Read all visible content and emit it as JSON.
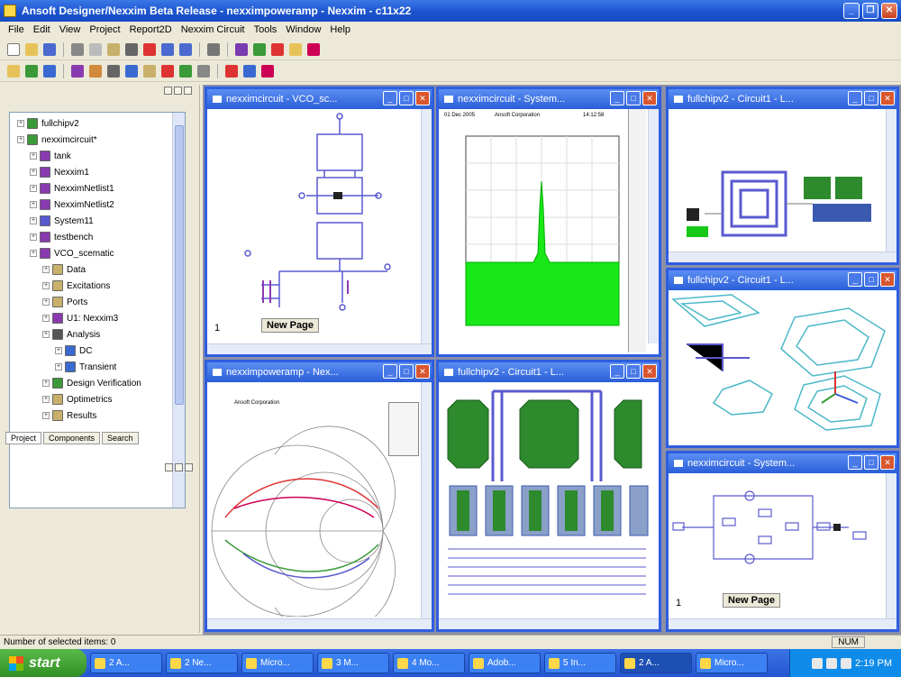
{
  "app": {
    "title": "Ansoft Designer/Nexxim Beta Release - nexximpoweramp - Nexxim - c11x22"
  },
  "menu": [
    "File",
    "Edit",
    "View",
    "Project",
    "Report2D",
    "Nexxim Circuit",
    "Tools",
    "Window",
    "Help"
  ],
  "tree": {
    "items": [
      {
        "label": "fullchipv2",
        "indent": 0,
        "icon": "project-icon",
        "color": "#3a9a3a"
      },
      {
        "label": "nexximcircuit*",
        "indent": 0,
        "icon": "project-icon",
        "color": "#3a9a3a"
      },
      {
        "label": "tank",
        "indent": 1,
        "icon": "circuit-icon",
        "color": "#8a3ab0"
      },
      {
        "label": "Nexxim1",
        "indent": 1,
        "icon": "circuit-icon",
        "color": "#8a3ab0"
      },
      {
        "label": "NexximNetlist1",
        "indent": 1,
        "icon": "circuit-icon",
        "color": "#8a3ab0"
      },
      {
        "label": "NexximNetlist2",
        "indent": 1,
        "icon": "circuit-icon",
        "color": "#8a3ab0"
      },
      {
        "label": "System11",
        "indent": 1,
        "icon": "system-icon",
        "color": "#5a5ad0"
      },
      {
        "label": "testbench",
        "indent": 1,
        "icon": "circuit-icon",
        "color": "#8a3ab0"
      },
      {
        "label": "VCO_scematic",
        "indent": 1,
        "icon": "circuit-icon",
        "color": "#8a3ab0"
      },
      {
        "label": "Data",
        "indent": 2,
        "icon": "folder-icon",
        "color": "#c9b06a"
      },
      {
        "label": "Excitations",
        "indent": 2,
        "icon": "folder-icon",
        "color": "#c9b06a"
      },
      {
        "label": "Ports",
        "indent": 2,
        "icon": "folder-icon",
        "color": "#c9b06a"
      },
      {
        "label": "U1: Nexxim3",
        "indent": 2,
        "icon": "circuit-icon",
        "color": "#8a3ab0"
      },
      {
        "label": "Analysis",
        "indent": 2,
        "icon": "analysis-icon",
        "color": "#555555"
      },
      {
        "label": "DC",
        "indent": 3,
        "icon": "dc-icon",
        "color": "#3a6ad0"
      },
      {
        "label": "Transient",
        "indent": 3,
        "icon": "transient-icon",
        "color": "#3a6ad0"
      },
      {
        "label": "Design Verification",
        "indent": 2,
        "icon": "check-icon",
        "color": "#3a9a3a"
      },
      {
        "label": "Optimetrics",
        "indent": 2,
        "icon": "optimetrics-icon",
        "color": "#c9b06a"
      },
      {
        "label": "Results",
        "indent": 2,
        "icon": "results-icon",
        "color": "#c9b06a"
      }
    ],
    "tabs": [
      "Project",
      "Components",
      "Search"
    ]
  },
  "windows": {
    "w1": {
      "title": "nexximcircuit - VCO_sc...",
      "page_num": "1",
      "new_page": "New Page"
    },
    "w2": {
      "title": "nexximcircuit - System...",
      "header_left": "01 Dec 2005",
      "header_mid": "Ansoft Corporation",
      "header_right": "14:12:58"
    },
    "w3": {
      "title": "fullchipv2 - Circuit1 - L..."
    },
    "w4": {
      "title": "fullchipv2 - Circuit1 - L..."
    },
    "w5": {
      "title": "nexximpoweramp - Nex...",
      "header": "Ansoft Corporation"
    },
    "w6": {
      "title": "fullchipv2 - Circuit1 - L..."
    },
    "w7": {
      "title": "nexximcircuit - System...",
      "page_num": "1",
      "new_page": "New Page"
    }
  },
  "status": {
    "text": "Number of selected items: 0",
    "mode": "NUM"
  },
  "taskbar": {
    "start": "start",
    "items": [
      "2 A...",
      "2 Ne...",
      "Micro...",
      "3 M...",
      "4 Mo...",
      "Adob...",
      "5 In...",
      "2 A...",
      "Micro..."
    ],
    "time": "2:19 PM"
  },
  "colors": {
    "accent": "#2e5ee0",
    "spectrum": "#18e818",
    "layout_green": "#2d8a2d"
  }
}
